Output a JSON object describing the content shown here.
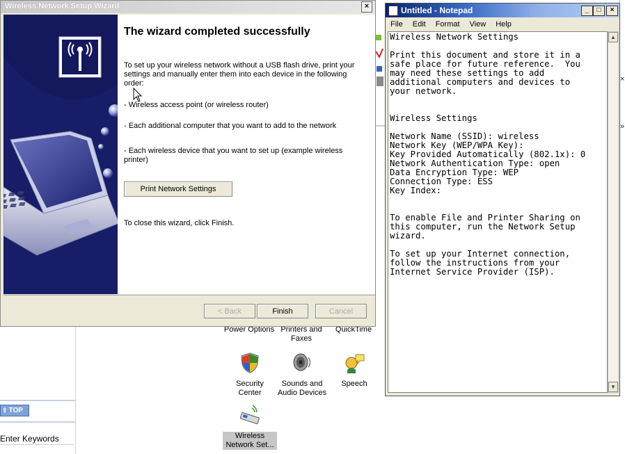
{
  "wizard": {
    "title": "Wireless Network Setup Wizard",
    "close_glyph": "×",
    "heading": "The wizard completed successfully",
    "intro": "To set up your wireless network without a USB flash drive, print your settings and manually enter them into each device in the following order:",
    "steps": [
      "- Wireless access point (or wireless router)",
      "- Each additional computer that you want to add to the network",
      "- Each wireless device that you want to set up (example wireless printer)"
    ],
    "print_button": "Print Network Settings",
    "close_note": "To close this wizard, click Finish.",
    "back_button": "< Back",
    "finish_button": "Finish",
    "cancel_button": "Cancel"
  },
  "notepad": {
    "title": "Untitled - Notepad",
    "minimize_glyph": "_",
    "maximize_glyph": "□",
    "close_glyph": "×",
    "menu": [
      "File",
      "Edit",
      "Format",
      "View",
      "Help"
    ],
    "content": "Wireless Network Settings\n\nPrint this document and store it in a\nsafe place for future reference.  You\nmay need these settings to add\nadditional computers and devices to\nyour network.\n\n\nWireless Settings\n\nNetwork Name (SSID): wireless\nNetwork Key (WEP/WPA Key):\nKey Provided Automatically (802.1x): 0\nNetwork Authentication Type: open\nData Encryption Type: WEP\nConnection Type: ESS\nKey Index:\n\n\nTo enable File and Printer Sharing on\nthis computer, run the Network Setup\nwizard.\n\nTo set up your Internet connection,\nfollow the instructions from your\nInternet Service Provider (ISP)."
  },
  "control_panel": {
    "top_button": "TOP",
    "keywords_label": "Enter Keywords",
    "items": [
      {
        "label": "Power Options",
        "icon": "power-options-icon"
      },
      {
        "label": "Printers and Faxes",
        "icon": "printers-icon"
      },
      {
        "label": "QuickTime",
        "icon": "quicktime-icon"
      },
      {
        "label": "Security Center",
        "icon": "shield-icon"
      },
      {
        "label": "Sounds and Audio Devices",
        "icon": "speaker-icon"
      },
      {
        "label": "Speech",
        "icon": "speech-icon"
      },
      {
        "label": "Wireless Network Set...",
        "icon": "wireless-card-icon"
      }
    ]
  },
  "colors": {
    "wizard_side": "#14195e",
    "notepad_title": "#0a246a",
    "dialog_face": "#ece9d8"
  }
}
